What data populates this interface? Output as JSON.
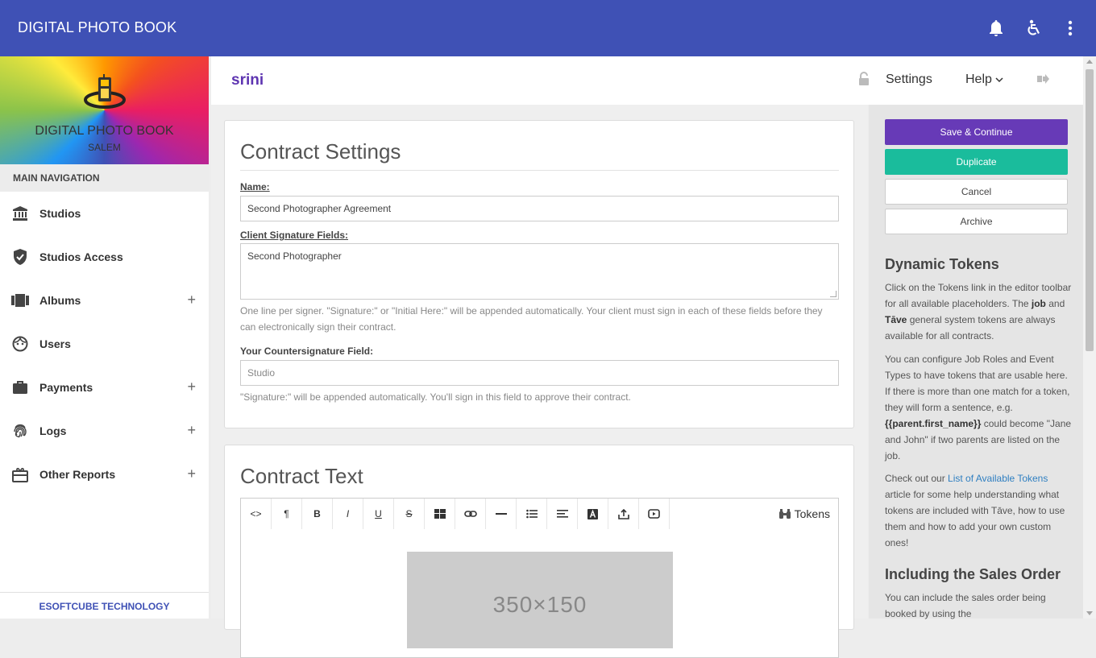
{
  "app": {
    "title": "DIGITAL PHOTO BOOK"
  },
  "sidebar": {
    "banner_title": "DIGITAL PHOTO BOOK",
    "banner_subtitle": "SALEM",
    "nav_header": "MAIN NAVIGATION",
    "items": [
      {
        "label": "Studios",
        "icon": "bank-icon",
        "expandable": false
      },
      {
        "label": "Studios Access",
        "icon": "shield-check-icon",
        "expandable": false
      },
      {
        "label": "Albums",
        "icon": "albums-icon",
        "expandable": true
      },
      {
        "label": "Users",
        "icon": "face-icon",
        "expandable": true
      },
      {
        "label": "Payments",
        "icon": "briefcase-icon",
        "expandable": true
      },
      {
        "label": "Logs",
        "icon": "fingerprint-icon",
        "expandable": true
      },
      {
        "label": "Other Reports",
        "icon": "gift-icon",
        "expandable": true
      }
    ],
    "plus_symbol": "+",
    "footer": "ESOFTCUBE TECHNOLOGY"
  },
  "subheader": {
    "username": "srini",
    "settings": "Settings",
    "help": "Help"
  },
  "contract_settings": {
    "title": "Contract Settings",
    "name_label": "Name:",
    "name_value": "Second Photographer Agreement",
    "client_sig_label": "Client Signature Fields:",
    "client_sig_value": "Second Photographer",
    "client_sig_help": "One line per signer. \"Signature:\" or \"Initial Here:\" will be appended automatically. Your client must sign in each of these fields before they can electronically sign their contract.",
    "counter_label": "Your Countersignature Field:",
    "counter_placeholder": "Studio",
    "counter_help": "\"Signature:\" will be appended automatically. You'll sign in this field to approve their contract."
  },
  "contract_text": {
    "title": "Contract Text",
    "toolbar": {
      "code": "<>",
      "paragraph": "¶",
      "bold": "B",
      "italic": "I",
      "underline": "U",
      "strike": "S",
      "tokens": "Tokens"
    },
    "image_placeholder": "350×150"
  },
  "right_panel": {
    "save_continue": "Save & Continue",
    "duplicate": "Duplicate",
    "cancel": "Cancel",
    "archive": "Archive",
    "dynamic_tokens_title": "Dynamic Tokens",
    "dt_p1_a": "Click on the Tokens link in the editor toolbar for all available placeholders. The ",
    "dt_p1_job": "job",
    "dt_p1_and": " and ",
    "dt_p1_tave": "Tāve",
    "dt_p1_b": " general system tokens are always available for all contracts.",
    "dt_p2_a": "You can configure Job Roles and Event Types to have tokens that are usable here. If there is more than one match for a token, they will form a sentence, e.g. ",
    "dt_p2_token": "{{parent.first_name}}",
    "dt_p2_b": " could become \"Jane and John\" if two parents are listed on the job.",
    "dt_p3_a": "Check out our ",
    "dt_p3_link": "List of Available Tokens",
    "dt_p3_b": " article for some help understanding what tokens are included with Tāve, how to use them and how to add your own custom ones!",
    "sales_title": "Including the Sales Order",
    "sales_text": "You can include the sales order being booked by using the"
  },
  "colors": {
    "topbar": "#3f51b5",
    "purple_button": "#673ab7",
    "teal_button": "#1abc9c",
    "username": "#5e35b1"
  }
}
